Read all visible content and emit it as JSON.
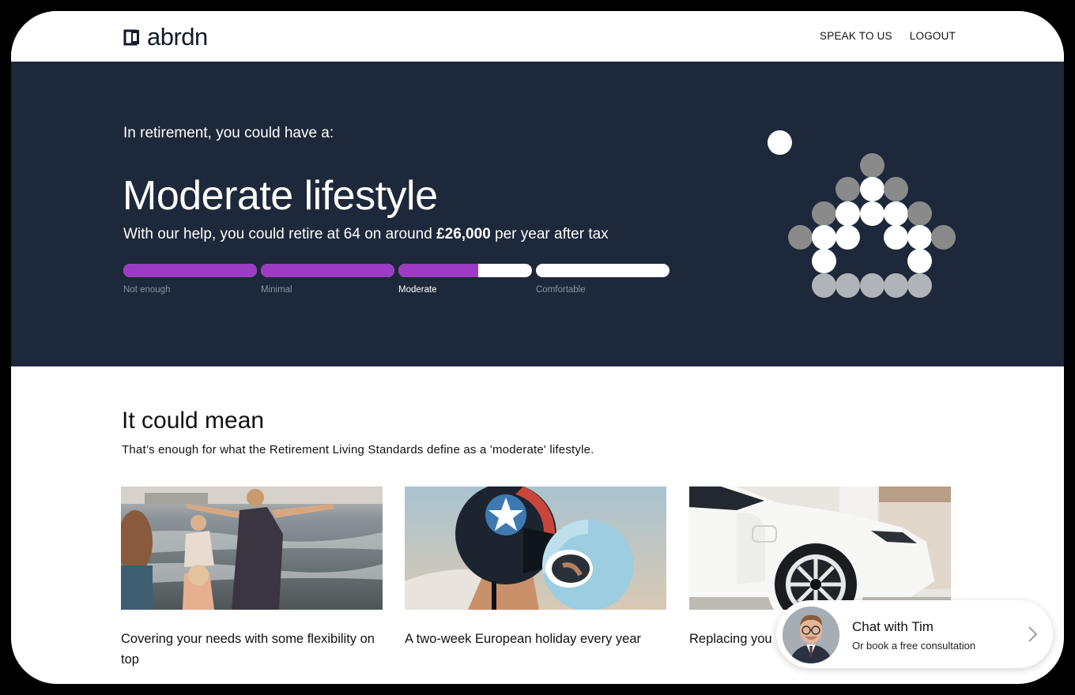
{
  "header": {
    "logo_text": "abrdn",
    "nav": [
      {
        "label": "SPEAK TO US"
      },
      {
        "label": "LOGOUT"
      }
    ]
  },
  "hero": {
    "kicker": "In retirement, you could have a:",
    "headline": "Moderate lifestyle",
    "sub_prefix": "With our help, you could retire at 64 on around",
    "sub_amount": "£26,000",
    "sub_suffix": "per year after tax",
    "segments": [
      {
        "label": "Not enough",
        "fill": 1.0,
        "active": false
      },
      {
        "label": "Minimal",
        "fill": 1.0,
        "active": false
      },
      {
        "label": "Moderate",
        "fill": 0.6,
        "active": true
      },
      {
        "label": "Comfortable",
        "fill": 0.0,
        "active": false
      }
    ],
    "colors": {
      "background": "#1d283a",
      "progress": "#9b3cc2"
    }
  },
  "section": {
    "title": "It could mean",
    "subtitle": "That’s enough for what the Retirement Living Standards define as a 'moderate' lifestyle."
  },
  "cards": [
    {
      "image": "beach-family-photo",
      "caption": "Covering your needs with some flexibility on top"
    },
    {
      "image": "helmets-photo",
      "caption": "A two-week European holiday every year"
    },
    {
      "image": "white-car-photo",
      "caption": "Replacing you"
    }
  ],
  "chat": {
    "title": "Chat with Tim",
    "subtitle": "Or book a free consultation"
  }
}
